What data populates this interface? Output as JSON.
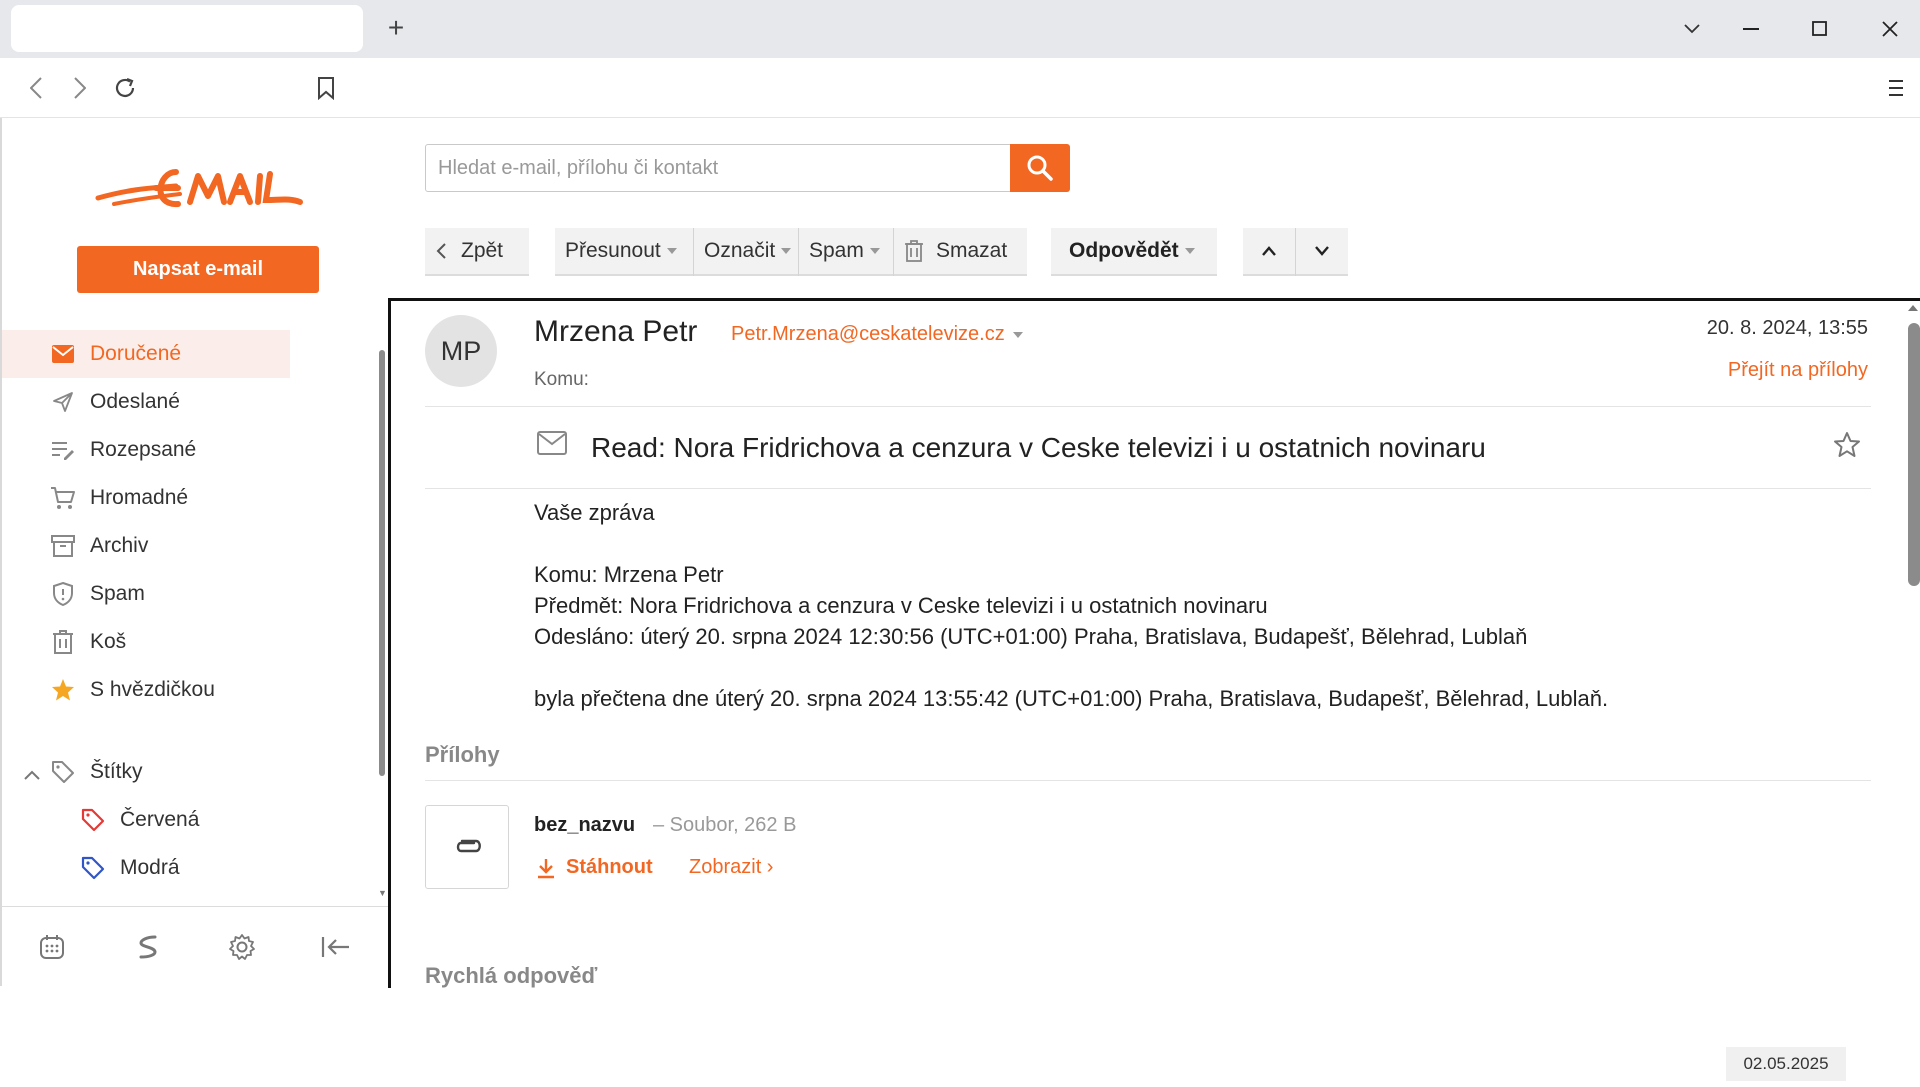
{
  "browser": {
    "new_tab": "+"
  },
  "brand": {
    "accent": "#f26722",
    "logo_text": "EMAIL"
  },
  "sidebar": {
    "compose_label": "Napsat e-mail",
    "folders": [
      {
        "label": "Doručené",
        "icon": "inbox-icon",
        "active": true
      },
      {
        "label": "Odeslané",
        "icon": "send-icon"
      },
      {
        "label": "Rozepsané",
        "icon": "drafts-icon"
      },
      {
        "label": "Hromadné",
        "icon": "cart-icon"
      },
      {
        "label": "Archiv",
        "icon": "archive-icon"
      },
      {
        "label": "Spam",
        "icon": "shield-icon"
      },
      {
        "label": "Koš",
        "icon": "trash-icon"
      },
      {
        "label": "S hvězdičkou",
        "icon": "star-icon"
      }
    ],
    "labels_title": "Štítky",
    "labels": [
      {
        "label": "Červená",
        "color": "#e53935"
      },
      {
        "label": "Modrá",
        "color": "#2f55c9"
      }
    ]
  },
  "search": {
    "placeholder": "Hledat e-mail, přílohu či kontakt"
  },
  "actions": {
    "back": "Zpět",
    "move": "Přesunout",
    "mark": "Označit",
    "spam": "Spam",
    "delete": "Smazat",
    "reply": "Odpovědět"
  },
  "message": {
    "avatar_initials": "MP",
    "sender_name": "Mrzena Petr",
    "sender_email": "Petr.Mrzena@ceskatelevize.cz",
    "to_label": "Komu:",
    "date": "20. 8. 2024, 13:55",
    "goto_attachments": "Přejít na přílohy",
    "subject": "Read: Nora Fridrichova a cenzura v Ceske televizi i u ostatnich novinaru",
    "body": {
      "line1": "Vaše zpráva",
      "line2": "Komu: Mrzena Petr",
      "line3": "Předmět: Nora Fridrichova a cenzura v Ceske televizi i u ostatnich novinaru",
      "line4": "Odesláno: úterý 20. srpna 2024 12:30:56 (UTC+01:00) Praha, Bratislava, Budapešť, Bělehrad, Lublaň",
      "line5": "byla přečtena dne úterý 20. srpna 2024 13:55:42 (UTC+01:00) Praha, Bratislava, Budapešť, Bělehrad, Lublaň."
    },
    "attachments_title": "Přílohy",
    "attachment": {
      "name": "bez_nazvu",
      "meta": "– Soubor, 262 B",
      "download": "Stáhnout",
      "view": "Zobrazit ›"
    },
    "quick_reply": "Rychlá odpověď"
  },
  "date_stamp": "02.05.2025"
}
